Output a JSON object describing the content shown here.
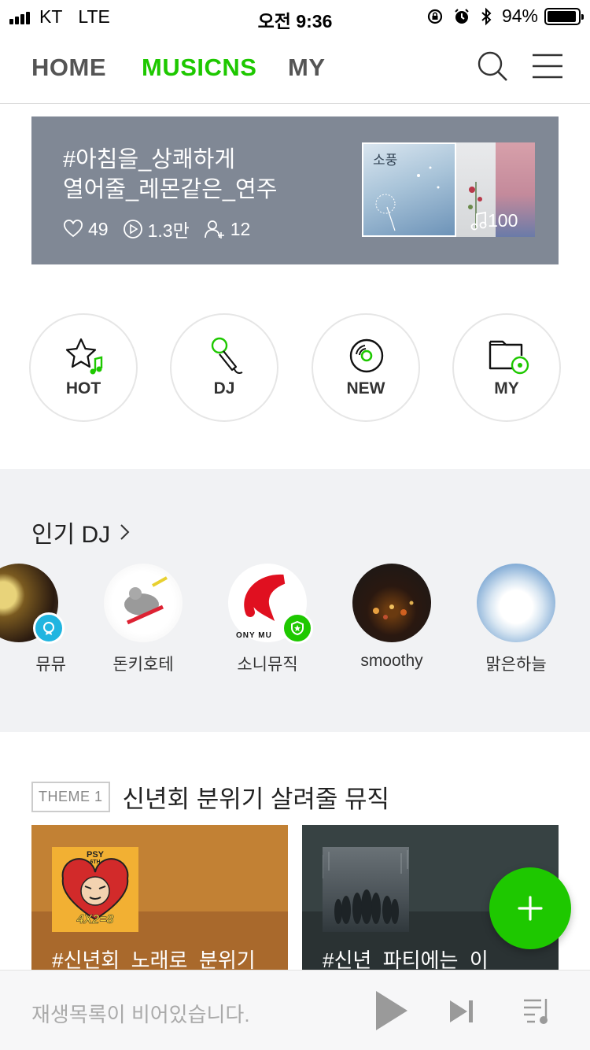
{
  "status_bar": {
    "carrier": "KT",
    "network": "LTE",
    "time": "오전 9:36",
    "battery": "94%",
    "battery_level": 0.94
  },
  "nav": {
    "tabs": [
      {
        "label": "HOME"
      },
      {
        "label": "MUSICNS"
      },
      {
        "label": "MY"
      }
    ],
    "active_tab": "MUSICNS",
    "accent": "#1ec800"
  },
  "banner": {
    "title_line1": "#아침을_상쾌하게",
    "title_line2": "열어줄_레몬같은_연주",
    "likes": "49",
    "plays": "1.3만",
    "followers": "12",
    "cover_text": "소풍",
    "track_count": "100",
    "background": "#808895"
  },
  "categories": [
    {
      "label": "HOT"
    },
    {
      "label": "DJ"
    },
    {
      "label": "NEW"
    },
    {
      "label": "MY"
    }
  ],
  "popular_dj": {
    "heading": "인기 DJ",
    "items": [
      {
        "name": "뮤뮤",
        "badge": "blue"
      },
      {
        "name": "돈키호테",
        "badge": ""
      },
      {
        "name": "소니뮤직",
        "badge": "green",
        "avatar_text": "ONY MU"
      },
      {
        "name": "smoothy",
        "badge": ""
      },
      {
        "name": "맑은하늘",
        "badge": ""
      }
    ]
  },
  "theme": {
    "tag": "THEME 1",
    "title": "신년회 분위기 살려줄 뮤직",
    "cards": [
      {
        "title": "#신년회_노래로_분위기",
        "art_text_top": "PSY",
        "art_text_sub": "6TH",
        "art_text_bottom": "4X2=8"
      },
      {
        "title": "#신년_파티에는_이"
      }
    ]
  },
  "player": {
    "empty_text": "재생목록이 비어있습니다."
  }
}
